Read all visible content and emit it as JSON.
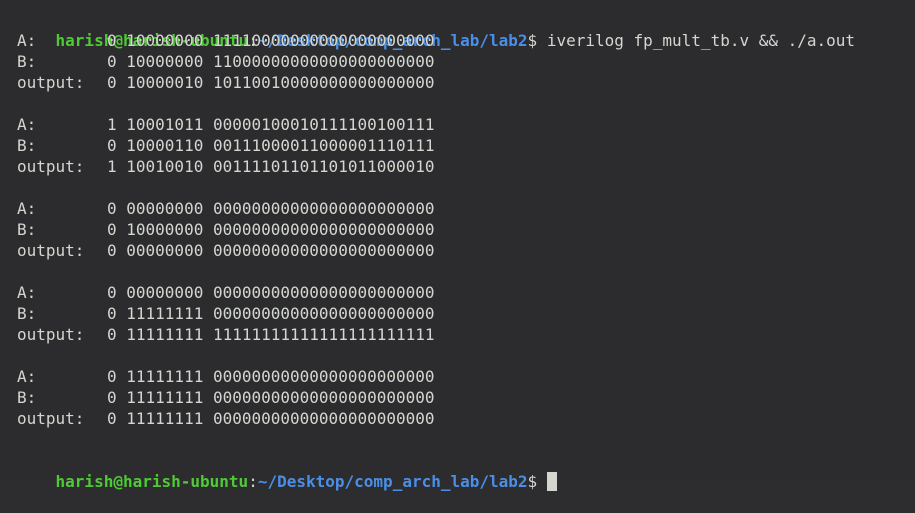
{
  "prompt": {
    "user_host": "harish@harish-ubuntu",
    "colon": ":",
    "path": "~/Desktop/comp_arch_lab/lab2",
    "dollar": "$ "
  },
  "command": "iverilog fp_mult_tb.v && ./a.out",
  "labels": {
    "a": "A:",
    "b": "B:",
    "output": "output:"
  },
  "blocks": [
    {
      "a": "0 10000000 11110000000000000000000",
      "b": "0 10000000 11000000000000000000000",
      "output": "0 10000010 10110010000000000000000"
    },
    {
      "a": "1 10001011 00000100010111100100111",
      "b": "0 10000110 00111000011000001110111",
      "output": "1 10010010 00111101101101011000010"
    },
    {
      "a": "0 00000000 00000000000000000000000",
      "b": "0 10000000 00000000000000000000000",
      "output": "0 00000000 00000000000000000000000"
    },
    {
      "a": "0 00000000 00000000000000000000000",
      "b": "0 11111111 00000000000000000000000",
      "output": "0 11111111 11111111111111111111111"
    },
    {
      "a": "0 11111111 00000000000000000000000",
      "b": "0 11111111 00000000000000000000000",
      "output": "0 11111111 00000000000000000000000"
    }
  ]
}
